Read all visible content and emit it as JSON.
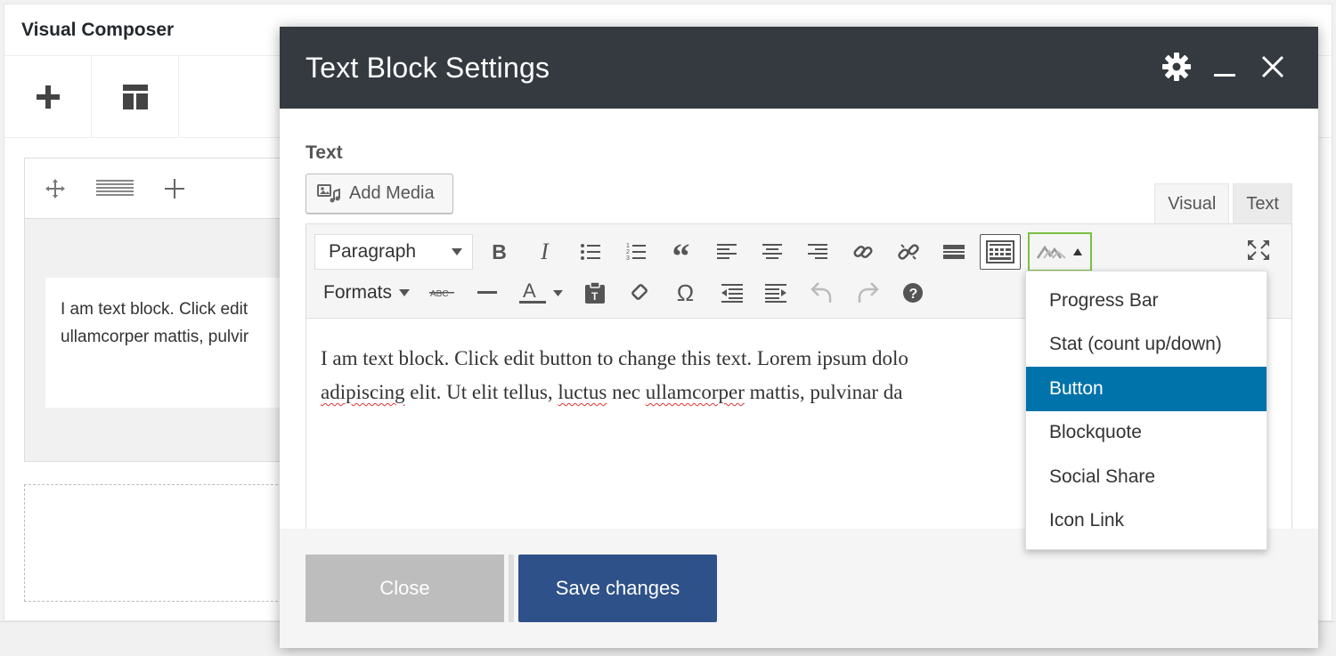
{
  "composer": {
    "title": "Visual Composer",
    "element_text_line1": "I am text block. Click edit",
    "element_text_line2": "ullamcorper mattis, pulvir"
  },
  "modal": {
    "title": "Text Block Settings",
    "field_label": "Text",
    "add_media_label": "Add Media",
    "tabs": {
      "visual": "Visual",
      "text": "Text"
    },
    "format_select": "Paragraph",
    "formats_label": "Formats",
    "content_line1": "I am text block. Click edit button to change this text. Lorem ipsum dolo",
    "content_line2_parts": [
      "adipiscing",
      " elit. Ut elit tellus, ",
      "luctus",
      " nec ",
      "ullamcorper",
      " mattis, pulvinar da"
    ],
    "close_label": "Close",
    "save_label": "Save changes"
  },
  "shortcode_menu": {
    "items": [
      "Progress Bar",
      "Stat (count up/down)",
      "Button",
      "Blockquote",
      "Social Share",
      "Icon Link"
    ],
    "selected": "Button"
  },
  "colors": {
    "header_bg": "#353a40",
    "save_button": "#2e5189",
    "menu_selected": "#0073aa",
    "shortcode_outline": "#7ac142"
  }
}
